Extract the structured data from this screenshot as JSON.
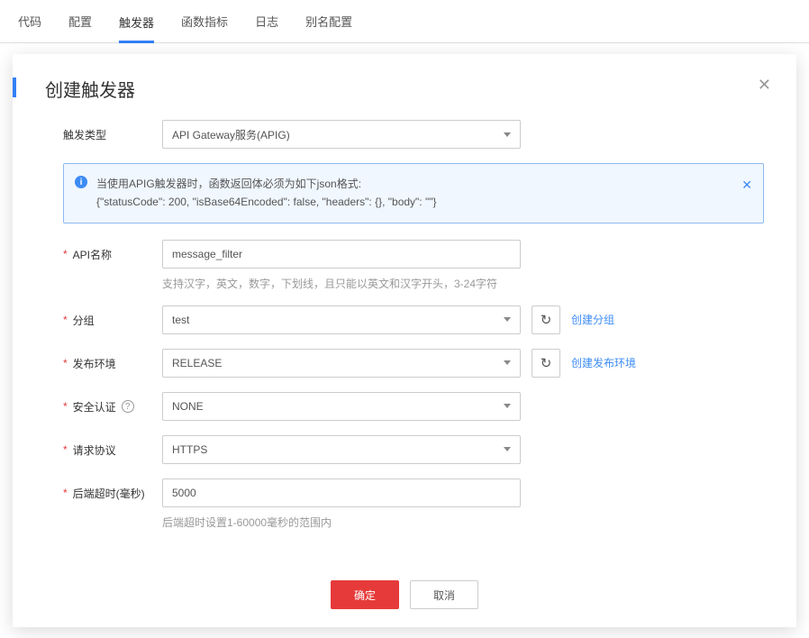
{
  "tabs": [
    "代码",
    "配置",
    "触发器",
    "函数指标",
    "日志",
    "别名配置"
  ],
  "activeTab": 2,
  "modal": {
    "title": "创建触发器",
    "form": {
      "triggerType": {
        "label": "触发类型",
        "value": "API Gateway服务(APIG)"
      },
      "alert": {
        "line1": "当使用APIG触发器时，函数返回体必须为如下json格式:",
        "line2": "{\"statusCode\": 200, \"isBase64Encoded\": false, \"headers\": {}, \"body\": \"\"}"
      },
      "apiName": {
        "label": "API名称",
        "value": "message_filter",
        "hint": "支持汉字，英文，数字，下划线，且只能以英文和汉字开头，3-24字符"
      },
      "group": {
        "label": "分组",
        "value": "test",
        "link": "创建分组"
      },
      "env": {
        "label": "发布环境",
        "value": "RELEASE",
        "link": "创建发布环境"
      },
      "auth": {
        "label": "安全认证",
        "value": "NONE"
      },
      "protocol": {
        "label": "请求协议",
        "value": "HTTPS"
      },
      "timeout": {
        "label": "后端超时(毫秒)",
        "value": "5000",
        "hint": "后端超时设置1-60000毫秒的范围内"
      }
    },
    "buttons": {
      "ok": "确定",
      "cancel": "取消"
    }
  }
}
